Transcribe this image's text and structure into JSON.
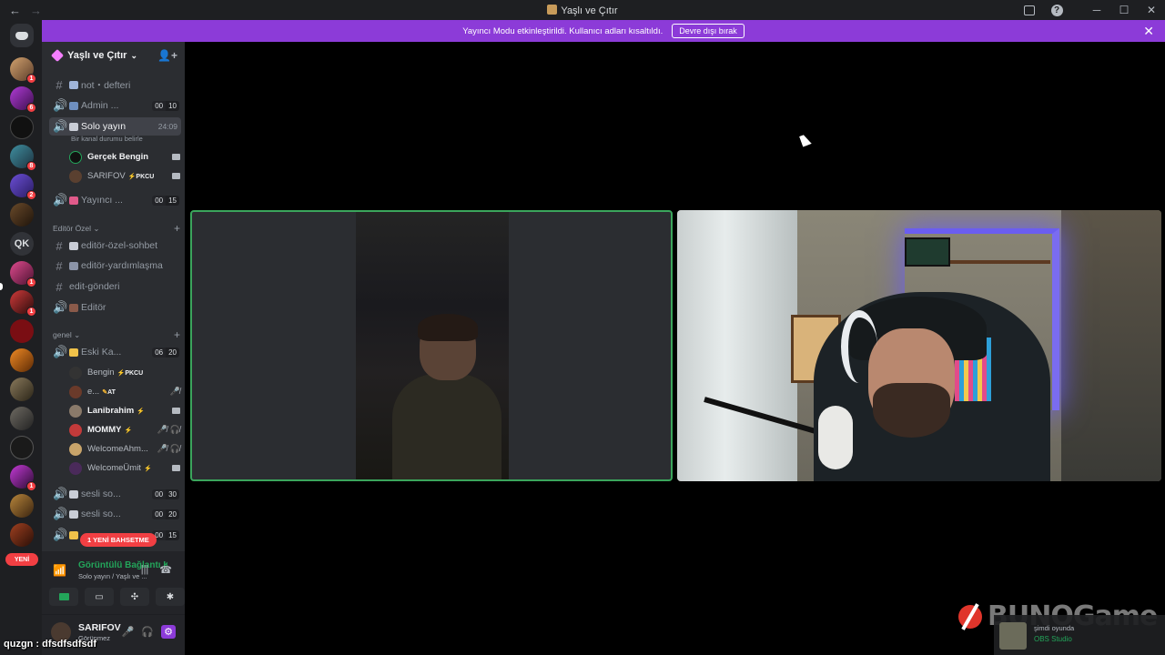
{
  "window": {
    "title": "Yaşlı ve Çıtır",
    "back": "←",
    "forward": "→",
    "minimize": "─",
    "maximize": "☐",
    "close": "✕",
    "help": "?"
  },
  "banner": {
    "text": "Yayıncı Modu etkinleştirildi. Kullanıcı adları kısaltıldı.",
    "button": "Devre dışı bırak",
    "close": "✕"
  },
  "guilds": {
    "badges": [
      "1",
      "6",
      "8",
      "2",
      "1",
      "1",
      "1"
    ],
    "qk_label": "QK",
    "new_label": "YENİ"
  },
  "server": {
    "name": "Yaşlı ve Çıtır",
    "chevron": "⌄"
  },
  "channels": {
    "not_defteri": "not・defteri",
    "admin": "Admin ...",
    "admin_counts": [
      "00",
      "10"
    ],
    "solo": "Solo yayın",
    "solo_time": "24:09",
    "solo_status": "Bir kanal durumu belirle",
    "yayinci": "Yayıncı ...",
    "yayinci_counts": [
      "00",
      "15"
    ],
    "editor_category": "Editör Özel",
    "editor_sohbet": "editör-özel-sohbet",
    "editor_yardim": "editör-yardımlaşma",
    "edit_gonderi": "edit-gönderi",
    "editor": "Editör",
    "genel_category": "genel",
    "eski": "Eski Ka...",
    "eski_counts": [
      "06",
      "20"
    ],
    "sesli1": "sesli so...",
    "sesli1_counts": [
      "00",
      "30"
    ],
    "sesli2": "sesli so...",
    "sesli2_counts": [
      "00",
      "20"
    ],
    "last_counts": [
      "00",
      "15"
    ],
    "mention": "1 YENİ BAHSETME"
  },
  "solo_users": [
    {
      "name": "Gerçek Bengin",
      "tag": ""
    },
    {
      "name": "SARIFOV",
      "tag": "PKCU"
    }
  ],
  "eski_users": [
    {
      "name": "Bengin",
      "tag": "PKCU"
    },
    {
      "name": "e...",
      "tag": "AT"
    },
    {
      "name": "Lanibrahim",
      "tag": ""
    },
    {
      "name": "MOMMY",
      "tag": ""
    },
    {
      "name": "WelcomeAhm...",
      "tag": ""
    },
    {
      "name": "WelcomeÜmit",
      "tag": ""
    }
  ],
  "voice": {
    "connection": "Görüntülü Bağlantı K",
    "location": "Solo yayın / Yaşlı ve ..."
  },
  "user_panel": {
    "name": "SARIFOV",
    "status": "Görünmez"
  },
  "overlay": {
    "text": "quzgn : dfsdfsdfsdf",
    "watermark": "BUNOGame"
  },
  "activity": {
    "label": "şimdi oyunda",
    "app": "OBS Studio"
  },
  "colors": {
    "accent": "#8c3bd8",
    "speaking": "#3ba55c",
    "badge": "#f23f43"
  }
}
